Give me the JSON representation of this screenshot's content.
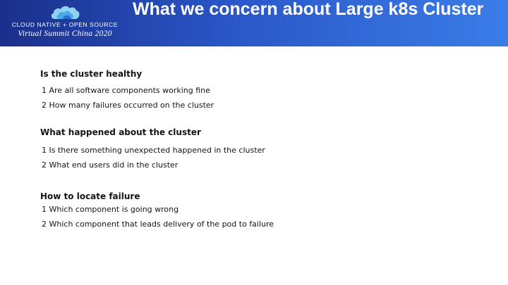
{
  "header": {
    "logo": {
      "line1": "CLOUD NATIVE + OPEN SOURCE",
      "line2": "Virtual Summit China 2020",
      "icon": "cloud-icon"
    },
    "title": "What we concern about Large k8s Cluster"
  },
  "colors": {
    "header_gradient_start": "#1a2f8a",
    "header_gradient_end": "#3b7de8",
    "title_text": "#ffffff",
    "body_text": "#151515"
  },
  "sections": [
    {
      "heading": "Is the cluster healthy",
      "items": [
        "1 Are all software components working fine",
        "2 How many failures occurred on the cluster"
      ]
    },
    {
      "heading": "What happened about the cluster",
      "items": [
        "1 Is there something unexpected happened in the cluster",
        "2 What end users did in the cluster"
      ]
    },
    {
      "heading": "How to locate failure",
      "items": [
        "1 Which component is going wrong",
        "2 Which component that leads delivery of the pod to failure"
      ]
    }
  ]
}
